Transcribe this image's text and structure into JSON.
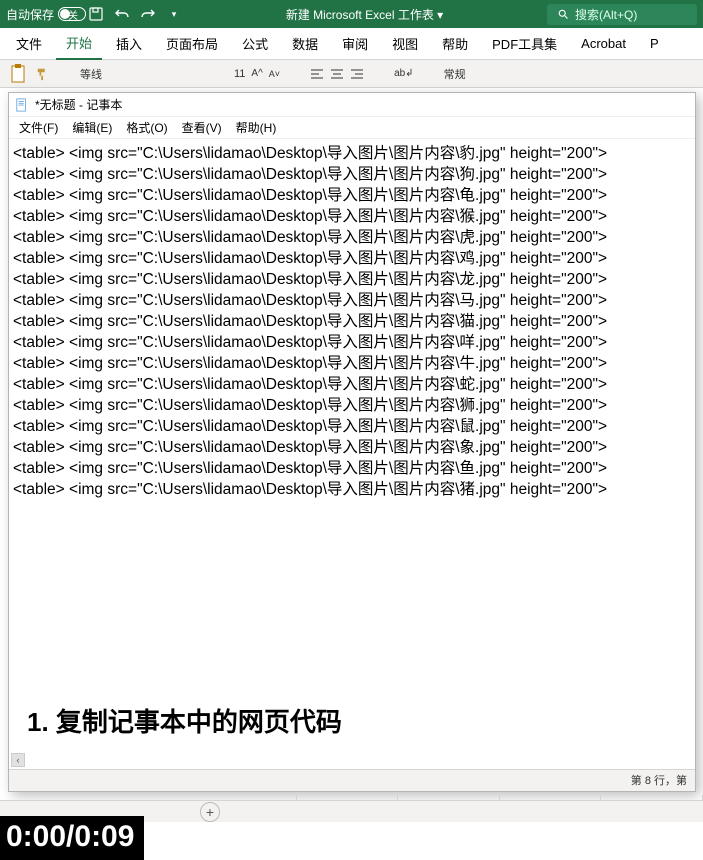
{
  "excel": {
    "autosave_label": "自动保存",
    "toggle_text": "关",
    "doc_title": "新建 Microsoft Excel 工作表 ▾",
    "search_placeholder": "搜索(Alt+Q)",
    "tabs": {
      "file": "文件",
      "home": "开始",
      "insert": "插入",
      "layout": "页面布局",
      "formula": "公式",
      "data": "数据",
      "review": "审阅",
      "view": "视图",
      "help": "帮助",
      "pdf": "PDF工具集",
      "acrobat": "Acrobat",
      "p": "P"
    },
    "ribbon": {
      "font_name": "等线",
      "font_size": "11",
      "format_label": "常规"
    },
    "sheet_plus": "+"
  },
  "notepad": {
    "title": "*无标题 - 记事本",
    "menus": {
      "file": "文件(F)",
      "edit": "编辑(E)",
      "format": "格式(O)",
      "view": "查看(V)",
      "help": "帮助(H)"
    },
    "cursor_glyph": "⅙",
    "lines": [
      "<table> <img src=\"C:\\Users\\lidamao\\Desktop\\导入图片\\图片内容\\豹.jpg\" height=\"200\">",
      "<table> <img src=\"C:\\Users\\lidamao\\Desktop\\导入图片\\图片内容\\狗.jpg\" height=\"200\">",
      "<table> <img src=\"C:\\Users\\lidamao\\Desktop\\导入图片\\图片内容\\龟.jpg\" height=\"200\">",
      "<table> <img src=\"C:\\Users\\lidamao\\Desktop\\导入图片\\图片内容\\猴.jpg\" height=\"200\">",
      "<table> <img src=\"C:\\Users\\lidamao\\Desktop\\导入图片\\图片内容\\虎.jpg\" height=\"200\">",
      "<table> <img src=\"C:\\Users\\lidamao\\Desktop\\导入图片\\图片内容\\鸡.jpg\" height=\"200\">",
      "<table> <img src=\"C:\\Users\\lidamao\\Desktop\\导入图片\\图片内容\\龙.jpg\" height=\"200\">",
      "<table> <img src=\"C:\\Users\\lidamao\\Desktop\\导入图片\\图片内容\\马.jpg\" height=\"200\">",
      "<table> <img src=\"C:\\Users\\lidamao\\Desktop\\导入图片\\图片内容\\猫.jpg\" height=\"200\">",
      "<table> <img src=\"C:\\Users\\lidamao\\Desktop\\导入图片\\图片内容\\咩.jpg\" height=\"200\">",
      "<table> <img src=\"C:\\Users\\lidamao\\Desktop\\导入图片\\图片内容\\牛.jpg\" height=\"200\">",
      "<table> <img src=\"C:\\Users\\lidamao\\Desktop\\导入图片\\图片内容\\蛇.jpg\" height=\"200\">",
      "<table> <img src=\"C:\\Users\\lidamao\\Desktop\\导入图片\\图片内容\\狮.jpg\" height=\"200\">",
      "<table> <img src=\"C:\\Users\\lidamao\\Desktop\\导入图片\\图片内容\\鼠.jpg\" height=\"200\">",
      "<table> <img src=\"C:\\Users\\lidamao\\Desktop\\导入图片\\图片内容\\象.jpg\" height=\"200\">",
      "<table> <img src=\"C:\\Users\\lidamao\\Desktop\\导入图片\\图片内容\\鱼.jpg\" height=\"200\">",
      "<table> <img src=\"C:\\Users\\lidamao\\Desktop\\导入图片\\图片内容\\猪.jpg\" height=\"200\">"
    ],
    "status": "第 8 行，第",
    "scroll_left": "‹"
  },
  "instruction": "1.  复制记事本中的网页代码",
  "timecode": "0:00/0:09"
}
